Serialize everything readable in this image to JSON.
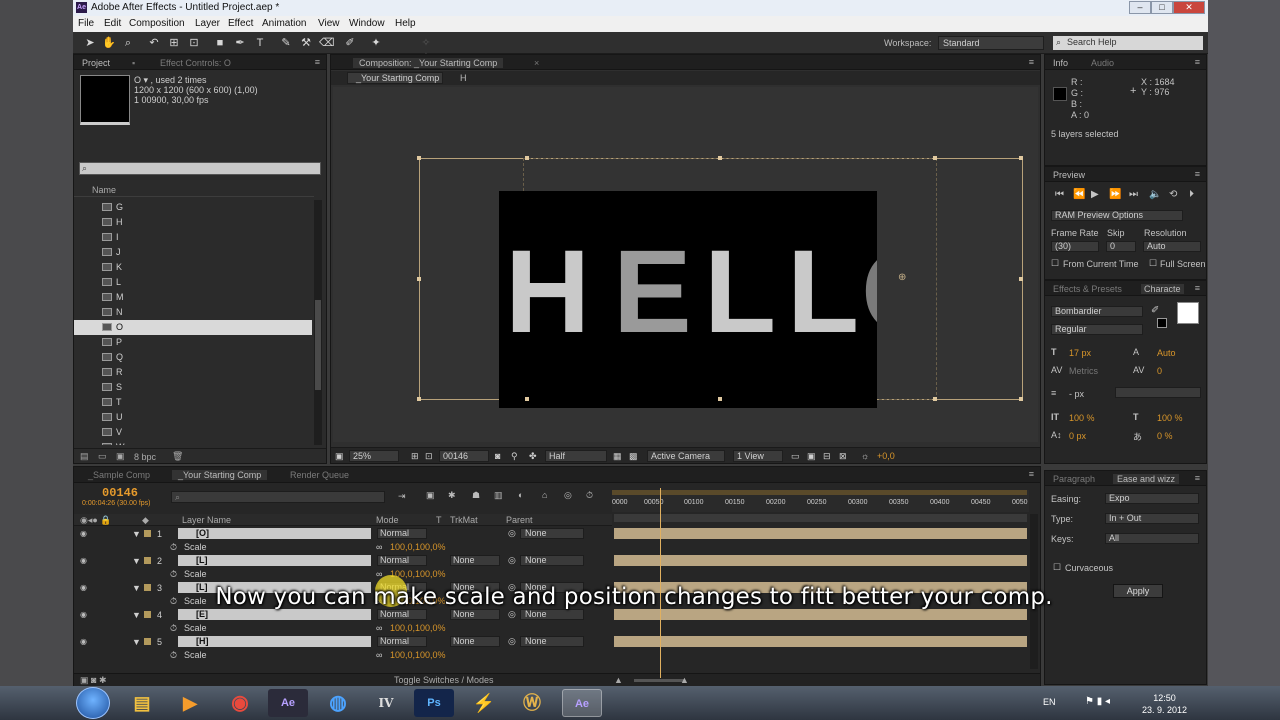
{
  "window": {
    "title": "Adobe After Effects - Untitled Project.aep *",
    "app_icon": "Ae",
    "minimize": "–",
    "maximize": "□",
    "close": "✕"
  },
  "menubar": [
    "File",
    "Edit",
    "Composition",
    "Layer",
    "Effect",
    "Animation",
    "View",
    "Window",
    "Help"
  ],
  "toolbar": {
    "workspace_label": "Workspace:",
    "workspace_value": "Standard",
    "search_placeholder": "Search Help"
  },
  "project_panel": {
    "tab_project": "Project",
    "tab_effect_controls": "Effect Controls: O",
    "item_info_line1": "O ▾ , used 2 times",
    "item_info_line2": "1200 x 1200  (600 x 600) (1,00)",
    "item_info_line3": "1 00900, 30,00 fps",
    "search_placeholder": "",
    "column_name": "Name",
    "items": [
      "G",
      "H",
      "I",
      "J",
      "K",
      "L",
      "M",
      "N",
      "O",
      "P",
      "Q",
      "R",
      "S",
      "T",
      "U",
      "V",
      "W"
    ],
    "selected_item": "O",
    "bpc": "8 bpc"
  },
  "composition_panel": {
    "tab": "Composition: _Your Starting Comp",
    "sub_tab": "_Your Starting Comp",
    "sub_tab_extra": "H",
    "canvas_text": [
      "H",
      "E",
      "L",
      "L",
      "O"
    ],
    "zoom": "25%",
    "timecode": "00146",
    "resolution": "Half",
    "camera": "Active Camera",
    "views": "1 View",
    "exposure": "+0,0"
  },
  "info_panel": {
    "tab_info": "Info",
    "tab_audio": "Audio",
    "r": "R :",
    "g": "G :",
    "b": "B :",
    "a": "A : 0",
    "x": "X : 1684",
    "y": "Y : 976",
    "status": "5 layers selected"
  },
  "preview_panel": {
    "tab": "Preview",
    "ram_preview": "RAM Preview Options",
    "frame_rate_label": "Frame Rate",
    "skip_label": "Skip",
    "resolution_label": "Resolution",
    "frame_rate_value": "(30)",
    "skip_value": "0",
    "resolution_value": "Auto",
    "from_current_time": "From Current Time",
    "full_screen": "Full Screen"
  },
  "character_panel": {
    "tab_effects": "Effects & Presets",
    "tab_character": "Characte",
    "font": "Bombardier",
    "style": "Regular",
    "size": "17 px",
    "leading": "Auto",
    "kerning": "Metrics",
    "tracking": "0",
    "stroke_unit": "- px",
    "vscale": "100 %",
    "hscale": "100 %",
    "baseline": "0 px",
    "tsume": "0 %"
  },
  "ease_panel": {
    "tab_paragraph": "Paragraph",
    "tab_ease": "Ease and wizz",
    "easing_label": "Easing:",
    "easing_value": "Expo",
    "type_label": "Type:",
    "type_value": "In + Out",
    "keys_label": "Keys:",
    "keys_value": "All",
    "curvaceous": "Curvaceous",
    "apply": "Apply"
  },
  "timeline": {
    "tabs": [
      "_Sample Comp",
      "_Your Starting Comp",
      "Render Queue"
    ],
    "active_tab": "_Your Starting Comp",
    "current_time": "00146",
    "sub_time": "0:00:04:26 (30.00 fps)",
    "col_layer_name": "Layer Name",
    "col_mode": "Mode",
    "col_t": "T",
    "col_trkmat": "TrkMat",
    "col_parent": "Parent",
    "ruler": [
      "0000",
      "00050",
      "00100",
      "00150",
      "00200",
      "00250",
      "00300",
      "00350",
      "00400",
      "00450",
      "0050"
    ],
    "layers": [
      {
        "num": "1",
        "name": "[O]",
        "mode": "Normal",
        "trkmat": "",
        "parent": "None",
        "scale": "100,0,100,0%"
      },
      {
        "num": "2",
        "name": "[L]",
        "mode": "Normal",
        "trkmat": "None",
        "parent": "None",
        "scale": "100,0,100,0%"
      },
      {
        "num": "3",
        "name": "[L]",
        "mode": "Normal",
        "trkmat": "None",
        "parent": "None",
        "scale": "100,0,100,0%"
      },
      {
        "num": "4",
        "name": "[E]",
        "mode": "Normal",
        "trkmat": "None",
        "parent": "None",
        "scale": "100,0,100,0%"
      },
      {
        "num": "5",
        "name": "[H]",
        "mode": "Normal",
        "trkmat": "None",
        "parent": "None",
        "scale": "100,0,100,0%"
      }
    ],
    "scale_label": "Scale",
    "toggle": "Toggle Switches / Modes"
  },
  "subtitle": "Now you can make scale and position changes to fitt better your comp.",
  "taskbar": {
    "apps": [
      "explorer",
      "media",
      "chrome",
      "Ae",
      "browser",
      "IV",
      "Ps",
      "script",
      "wow",
      "Ae"
    ],
    "lang": "EN",
    "time": "12:50",
    "date": "23. 9. 2012"
  }
}
